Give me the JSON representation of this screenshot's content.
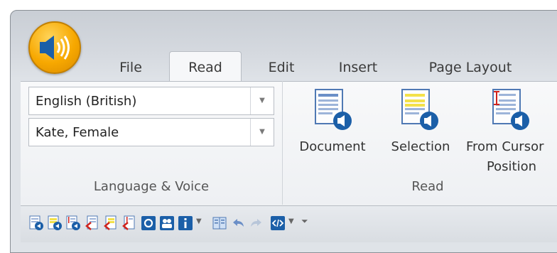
{
  "tabs": [
    {
      "label": "File"
    },
    {
      "label": "Read"
    },
    {
      "label": "Edit"
    },
    {
      "label": "Insert"
    },
    {
      "label": "Page Layout"
    }
  ],
  "active_tab": "Read",
  "language_voice": {
    "language_value": "English (British)",
    "voice_value": "Kate, Female",
    "group_label": "Language & Voice"
  },
  "read_group": {
    "buttons": [
      {
        "label": "Document",
        "icon": "read-document-icon"
      },
      {
        "label": "Selection",
        "icon": "read-selection-icon"
      },
      {
        "label_line1": "From Cursor",
        "label_line2": "Position",
        "icon": "read-from-cursor-icon"
      }
    ],
    "group_label": "Read"
  },
  "quick_access_toolbar": {
    "icons": [
      "prev-sentence-icon",
      "read-selection-small-icon",
      "read-from-cursor-small-icon",
      "stop-document-icon",
      "stop-selection-icon",
      "stop-cursor-icon",
      "settings-icon",
      "voices-icon",
      "info-icon",
      "book-icon",
      "undo-icon",
      "redo-icon",
      "code-icon",
      "customize-toolbar-icon"
    ]
  },
  "colors": {
    "accent_blue": "#1b5fa8",
    "app_orange": "#f7a800",
    "doc_yellow": "#f3e14a",
    "cursor_red": "#d0231c"
  }
}
